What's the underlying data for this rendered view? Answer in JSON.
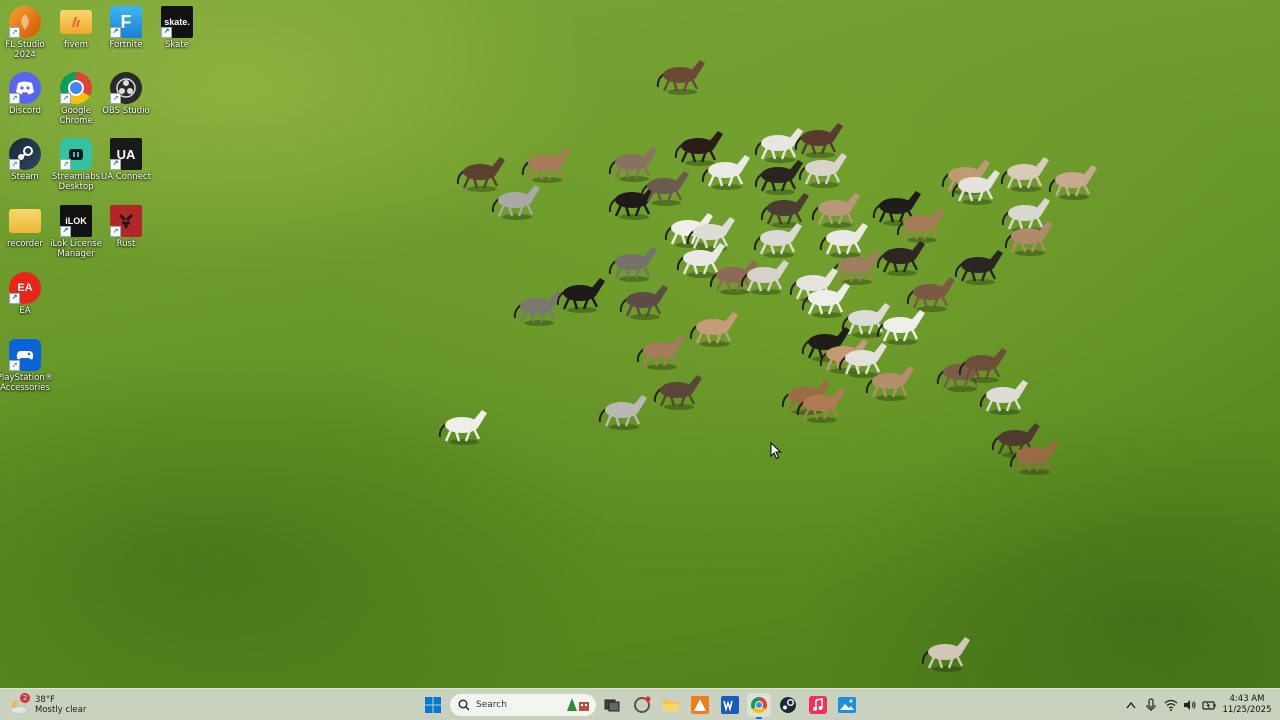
{
  "desktop": {
    "icons": [
      {
        "label": "FL Studio 2024",
        "name": "fl-studio-icon"
      },
      {
        "label": "fivem",
        "name": "fivem-folder-icon"
      },
      {
        "label": "Fortnite",
        "name": "fortnite-icon"
      },
      {
        "label": "Skate",
        "name": "skate-icon"
      },
      {
        "label": "Discord",
        "name": "discord-icon"
      },
      {
        "label": "Google Chrome",
        "name": "chrome-icon"
      },
      {
        "label": "OBS Studio",
        "name": "obs-icon"
      },
      {
        "label": "Steam",
        "name": "steam-icon"
      },
      {
        "label": "Streamlabs Desktop",
        "name": "streamlabs-icon"
      },
      {
        "label": "UA Connect",
        "name": "ua-connect-icon"
      },
      {
        "label": "recorder",
        "name": "recorder-folder-icon"
      },
      {
        "label": "iLok License Manager",
        "name": "ilok-icon"
      },
      {
        "label": "Rust",
        "name": "rust-icon"
      },
      {
        "label": "EA",
        "name": "ea-icon"
      },
      {
        "label": "PlayStation® Accessories",
        "name": "playstation-accessories-icon"
      }
    ],
    "tile_text": {
      "fortnite": "F",
      "skate": "skate.",
      "ua": "UA",
      "ilok": "iLOK",
      "ea": "EA"
    }
  },
  "taskbar": {
    "weather": {
      "temp": "38°F",
      "condition": "Mostly clear",
      "badge": "2"
    },
    "search_placeholder": "Search",
    "pinned": [
      "start-button",
      "task-view",
      "copilot",
      "file-explorer",
      "audiokinetic",
      "word",
      "chrome",
      "steam",
      "music-app",
      "photos-app"
    ],
    "clock": {
      "time": "4:43 AM",
      "date": "11/25/2025"
    }
  },
  "colors": {
    "grass": "#6b9a2b",
    "taskbar": "#c4ceb8",
    "accent": "#0078d4"
  }
}
